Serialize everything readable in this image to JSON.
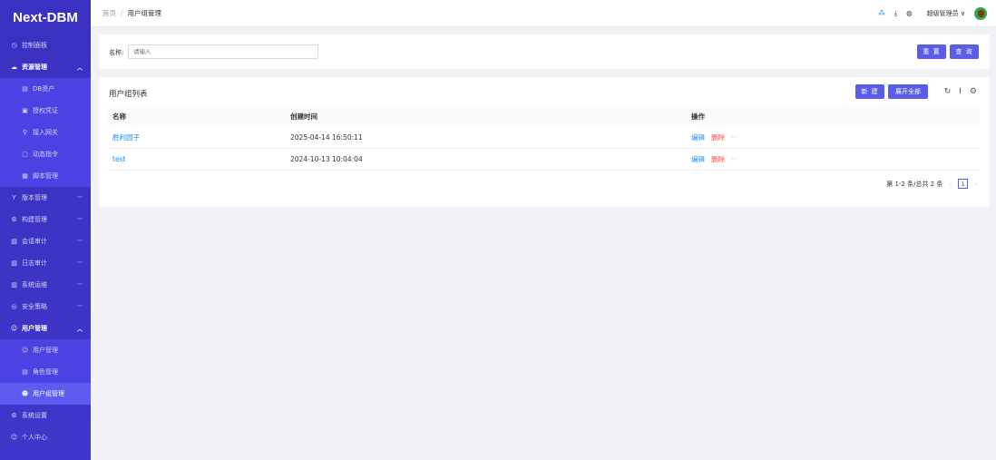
{
  "app": {
    "logo": "Next-DBM"
  },
  "sidebar": {
    "items": [
      {
        "label": "控制面板",
        "icon": "dashboard-icon"
      },
      {
        "label": "资源管理",
        "icon": "cloud-icon",
        "expanded": true,
        "children": [
          {
            "label": "DB资产",
            "icon": "database-icon"
          },
          {
            "label": "授权凭证",
            "icon": "credential-icon"
          },
          {
            "label": "接入网关",
            "icon": "link-icon"
          },
          {
            "label": "动态指令",
            "icon": "command-icon"
          },
          {
            "label": "脚本管理",
            "icon": "script-icon"
          }
        ]
      },
      {
        "label": "版本管理",
        "icon": "branch-icon"
      },
      {
        "label": "构建管理",
        "icon": "build-icon"
      },
      {
        "label": "会话审计",
        "icon": "audit-icon"
      },
      {
        "label": "日志审计",
        "icon": "log-icon"
      },
      {
        "label": "系统运维",
        "icon": "ops-icon"
      },
      {
        "label": "安全策略",
        "icon": "shield-icon"
      },
      {
        "label": "用户管理",
        "icon": "user-icon",
        "expanded": true,
        "children": [
          {
            "label": "用户管理",
            "icon": "user-icon"
          },
          {
            "label": "角色管理",
            "icon": "role-icon"
          },
          {
            "label": "用户组管理",
            "icon": "group-icon",
            "selected": true
          }
        ]
      },
      {
        "label": "系统设置",
        "icon": "settings-icon"
      },
      {
        "label": "个人中心",
        "icon": "profile-icon"
      }
    ]
  },
  "header": {
    "breadcrumb": [
      "首页",
      "用户组管理"
    ],
    "user": "超级管理员"
  },
  "search": {
    "label": "名称:",
    "placeholder": "请输入",
    "reset": "重 置",
    "query": "查 询"
  },
  "table": {
    "title": "用户组列表",
    "new": "新 建",
    "expand": "展开全部",
    "columns": [
      "名称",
      "创建时间",
      "操作"
    ],
    "rows": [
      {
        "name": "胜利园子",
        "created": "2025-04-14 16:50:11"
      },
      {
        "name": "test",
        "created": "2024-10-13 10:04:04"
      }
    ],
    "actions": {
      "edit": "编辑",
      "delete": "删除",
      "more": "···"
    },
    "pagination": {
      "summary": "第 1-2 条/总共 2 条",
      "page": "1"
    }
  },
  "colors": {
    "sidebar": "#3d34c6",
    "accent": "#5b5ce8",
    "link": "#1890ff",
    "danger": "#ff4d4f"
  }
}
